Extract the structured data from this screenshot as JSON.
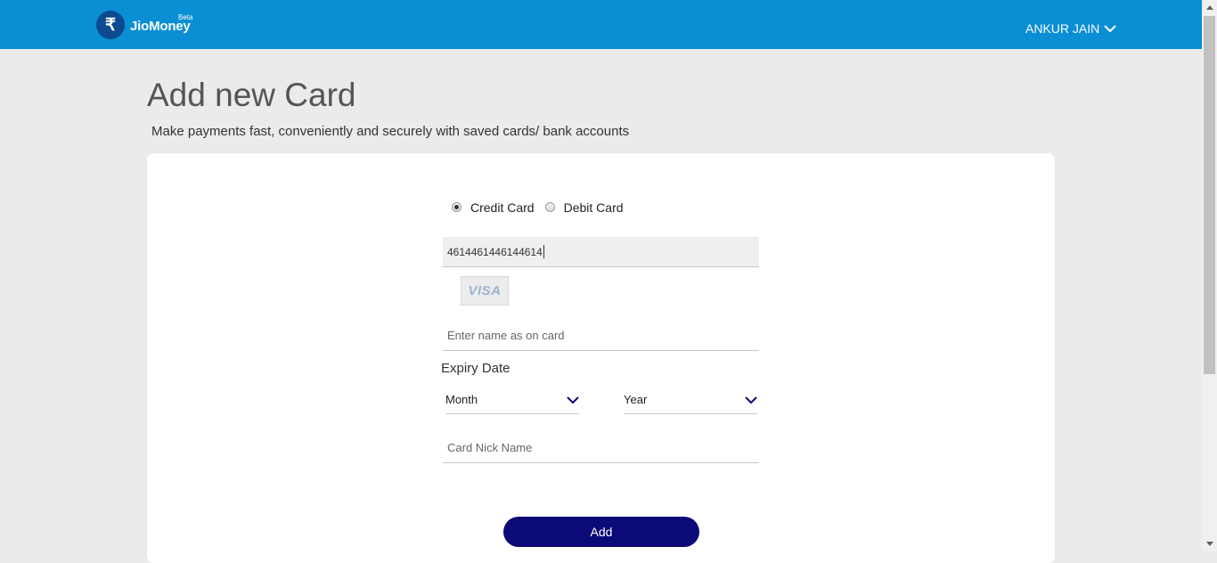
{
  "header": {
    "logo_symbol": "₹",
    "logo_text": "JioMoney",
    "logo_beta": "Beta",
    "user_name": "ANKUR JAIN"
  },
  "page": {
    "title": "Add new Card",
    "subtitle": "Make payments fast, conveniently and securely with saved cards/ bank accounts"
  },
  "form": {
    "card_type_options": [
      {
        "label": "Credit Card",
        "selected": true
      },
      {
        "label": "Debit Card",
        "selected": false
      }
    ],
    "card_number_value": "4614461446144614",
    "card_brand": "VISA",
    "name_placeholder": "Enter name as on card",
    "expiry_label": "Expiry Date",
    "month_value": "Month",
    "year_value": "Year",
    "nickname_placeholder": "Card Nick Name",
    "add_label": "Add"
  },
  "colors": {
    "header_bg": "#0a8ed4",
    "button_bg": "#0b0a77",
    "page_bg": "#ebebeb",
    "panel_bg": "#ffffff"
  }
}
